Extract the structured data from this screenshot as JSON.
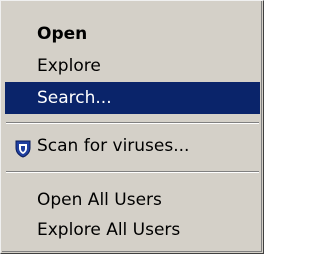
{
  "context_menu": {
    "items": [
      {
        "label": "Open",
        "bold": true
      },
      {
        "label": "Explore"
      },
      {
        "label": "Search...",
        "highlighted": true
      },
      {
        "label": "Scan for viruses...",
        "icon": "shield-icon"
      },
      {
        "label": "Open All Users"
      },
      {
        "label": "Explore All Users"
      }
    ],
    "colors": {
      "menu_bg": "#d4d0c8",
      "highlight_bg": "#0a246a",
      "highlight_text": "#ffffff",
      "icon_blue": "#1f3fa0"
    }
  }
}
